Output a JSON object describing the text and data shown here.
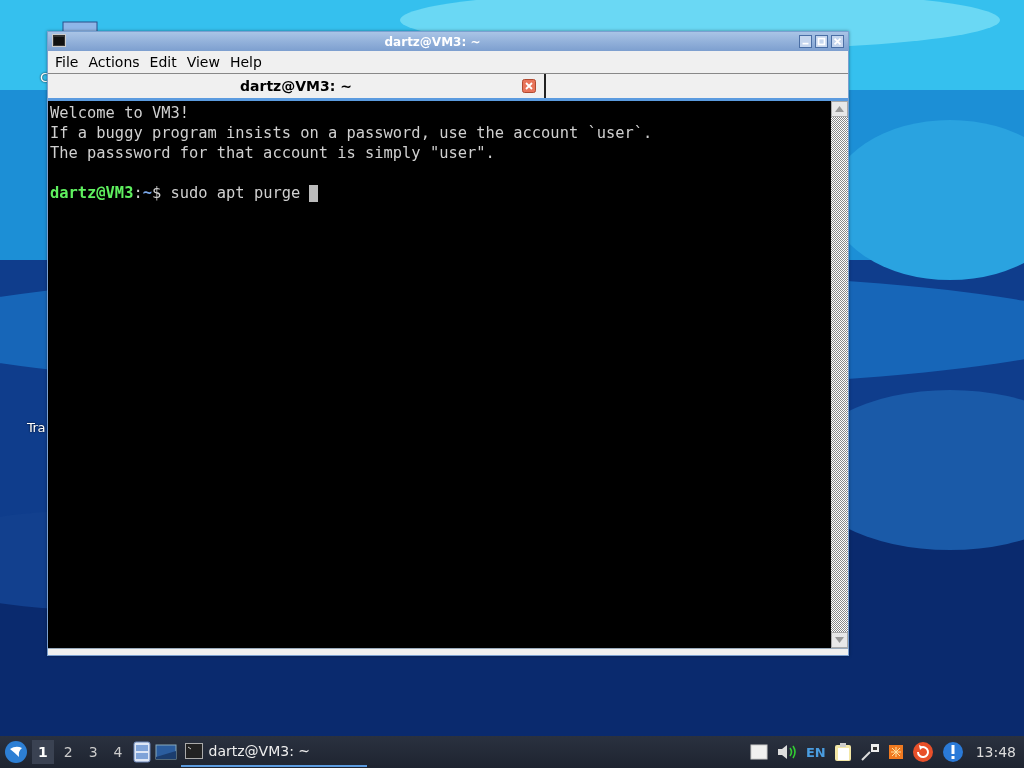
{
  "desktop": {
    "icons": [
      {
        "label": "C"
      },
      {
        "label": "Tra"
      }
    ]
  },
  "window": {
    "title": "dartz@VM3: ~",
    "menu": [
      "File",
      "Actions",
      "Edit",
      "View",
      "Help"
    ],
    "tabs": [
      {
        "label": "dartz@VM3: ~",
        "selected": true
      }
    ],
    "terminal": {
      "lines": [
        "Welcome to VM3!",
        "If a buggy program insists on a password, use the account `user`.",
        "The passsword for that account is simply \"user\"."
      ],
      "prompt": {
        "user_host": "dartz@VM3",
        "separator": ":",
        "path": "~",
        "symbol": "$",
        "command": "sudo apt purge"
      }
    }
  },
  "taskbar": {
    "workspaces": [
      {
        "label": "1",
        "selected": true
      },
      {
        "label": "2",
        "selected": false
      },
      {
        "label": "3",
        "selected": false
      },
      {
        "label": "4",
        "selected": false
      }
    ],
    "tasks": [
      {
        "label": "dartz@VM3: ~",
        "selected": true
      }
    ],
    "keyboard_layout": "EN",
    "clock": "13:48"
  }
}
